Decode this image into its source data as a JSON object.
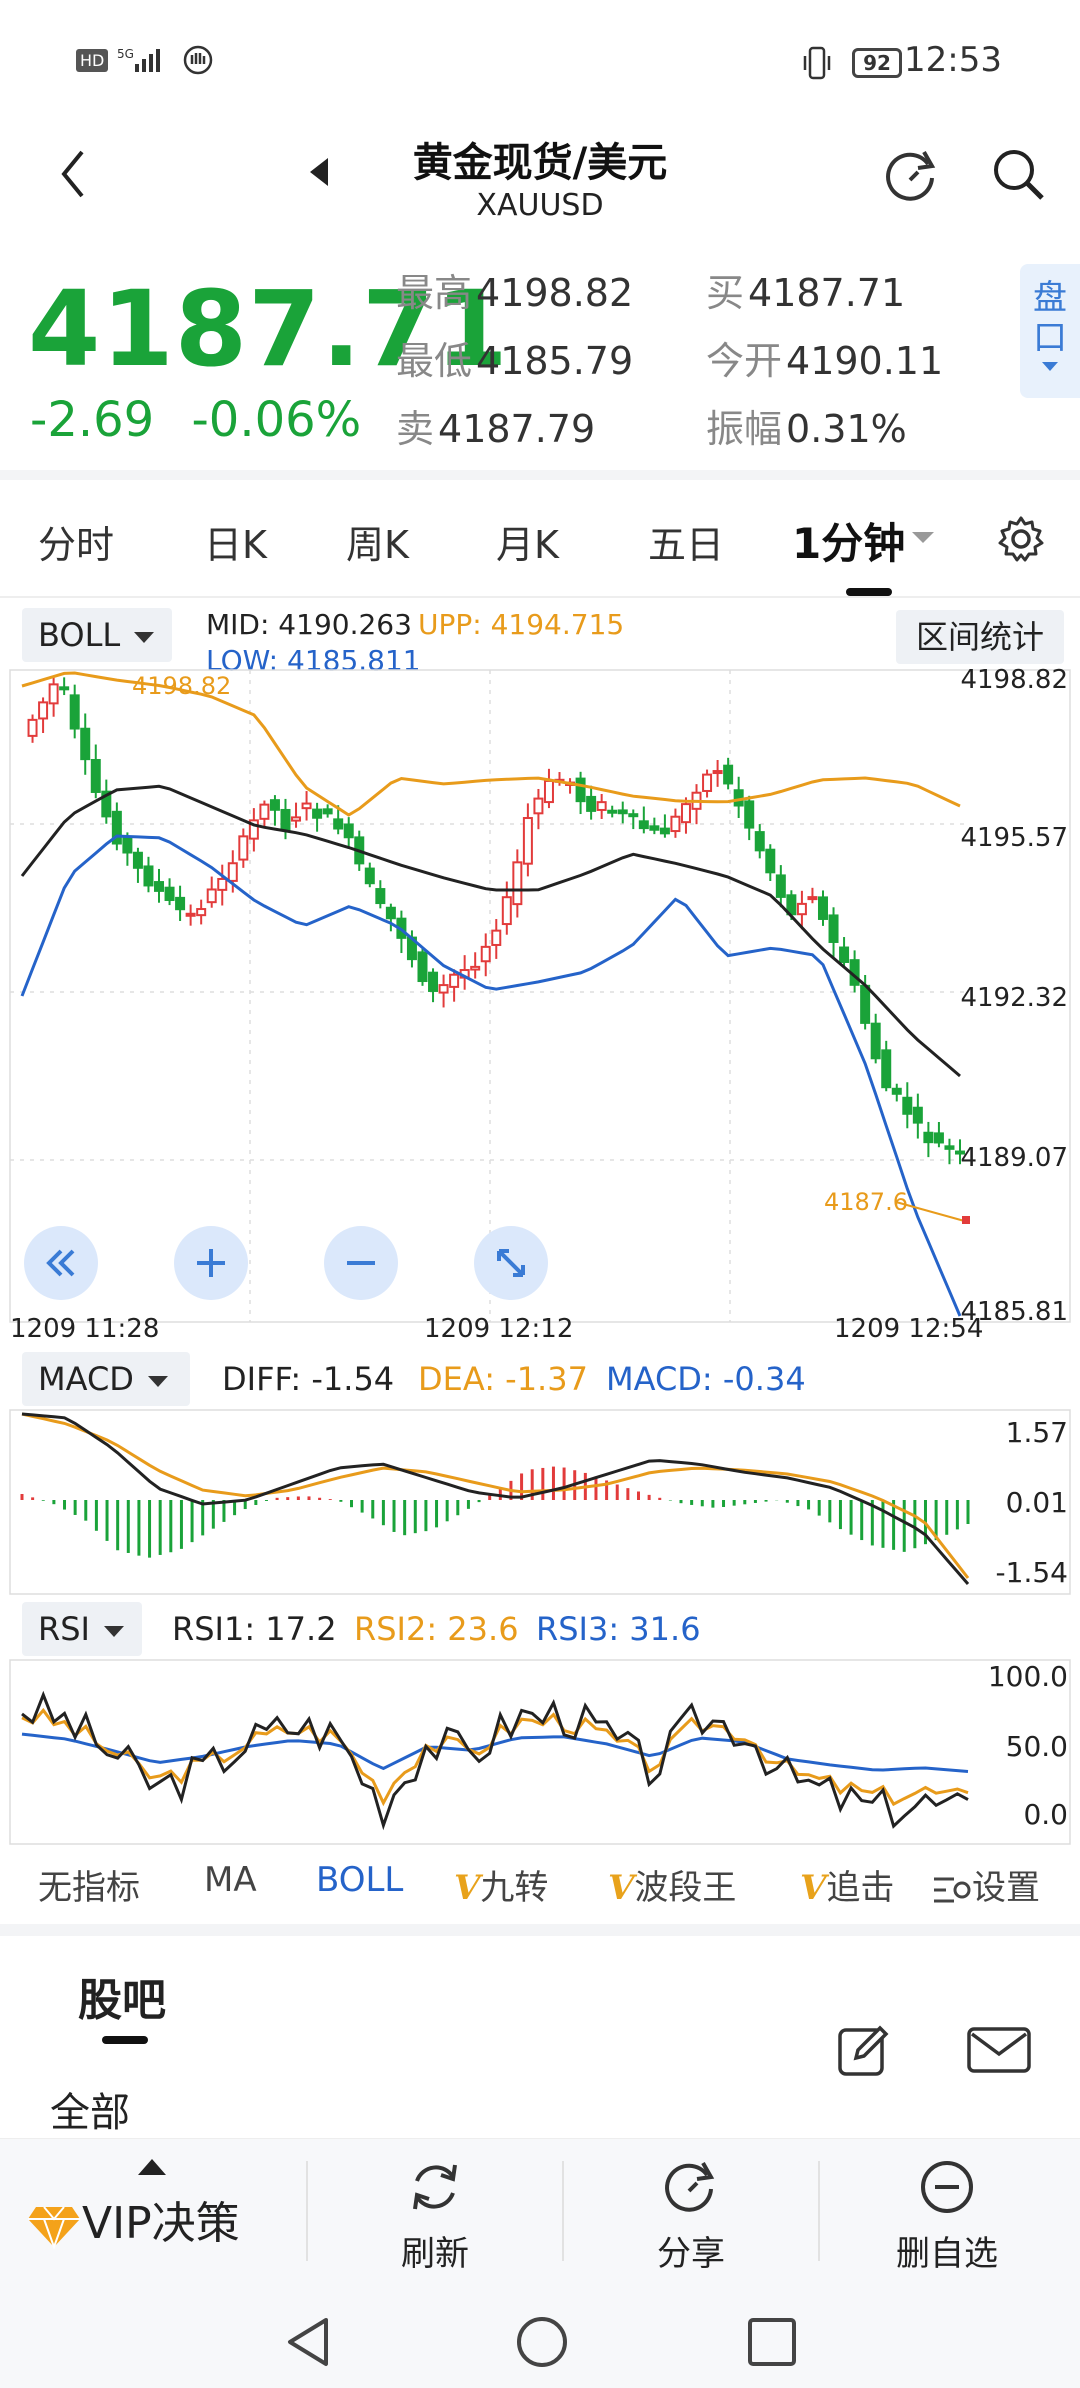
{
  "status": {
    "network": "HD 5G",
    "battery": "92",
    "time": "12:53"
  },
  "header": {
    "title": "黄金现货/美元",
    "symbol": "XAUUSD"
  },
  "quote": {
    "price": "4187.71",
    "change": "-2.69",
    "change_pct": "-0.06%",
    "high_label": "最高",
    "high": "4198.82",
    "low_label": "最低",
    "low": "4185.79",
    "sell_label": "卖",
    "sell": "4187.79",
    "buy_label": "买",
    "buy": "4187.71",
    "open_label": "今开",
    "open": "4190.11",
    "amp_label": "振幅",
    "amp": "0.31%",
    "pankou": "盘口"
  },
  "tabs": [
    "分时",
    "日K",
    "周K",
    "月K",
    "五日",
    "1分钟"
  ],
  "boll": {
    "tag": "BOLL",
    "mid": "MID: 4190.263",
    "upp": "UPP: 4194.715",
    "low": "LOW: 4185.811",
    "range_btn": "区间统计",
    "axis": [
      "4198.82",
      "4195.57",
      "4192.32",
      "4189.07",
      "4185.81"
    ],
    "max_label": "4198.82",
    "last_label": "4187.6",
    "times": [
      "1209  11:28",
      "1209  12:12",
      "1209  12:54"
    ]
  },
  "macd": {
    "tag": "MACD",
    "diff": "DIFF: -1.54",
    "dea": "DEA: -1.37",
    "macd": "MACD: -0.34",
    "axis": [
      "1.57",
      "0.01",
      "-1.54"
    ]
  },
  "rsi": {
    "tag": "RSI",
    "rsi1": "RSI1: 17.2",
    "rsi2": "RSI2: 23.6",
    "rsi3": "RSI3: 31.6",
    "axis": [
      "100.0",
      "50.0",
      "0.0"
    ]
  },
  "indicators": [
    "无指标",
    "MA",
    "BOLL",
    "九转",
    "波段王",
    "追击",
    "设置"
  ],
  "guba": {
    "title": "股吧",
    "filter": "全部"
  },
  "bottom": {
    "vip": "VIP决策",
    "refresh": "刷新",
    "share": "分享",
    "remove": "删自选"
  },
  "colors": {
    "up": "#e23b3b",
    "down": "#1aa339",
    "upp": "#e89b1b",
    "low": "#2563c9",
    "mid": "#222222"
  }
}
